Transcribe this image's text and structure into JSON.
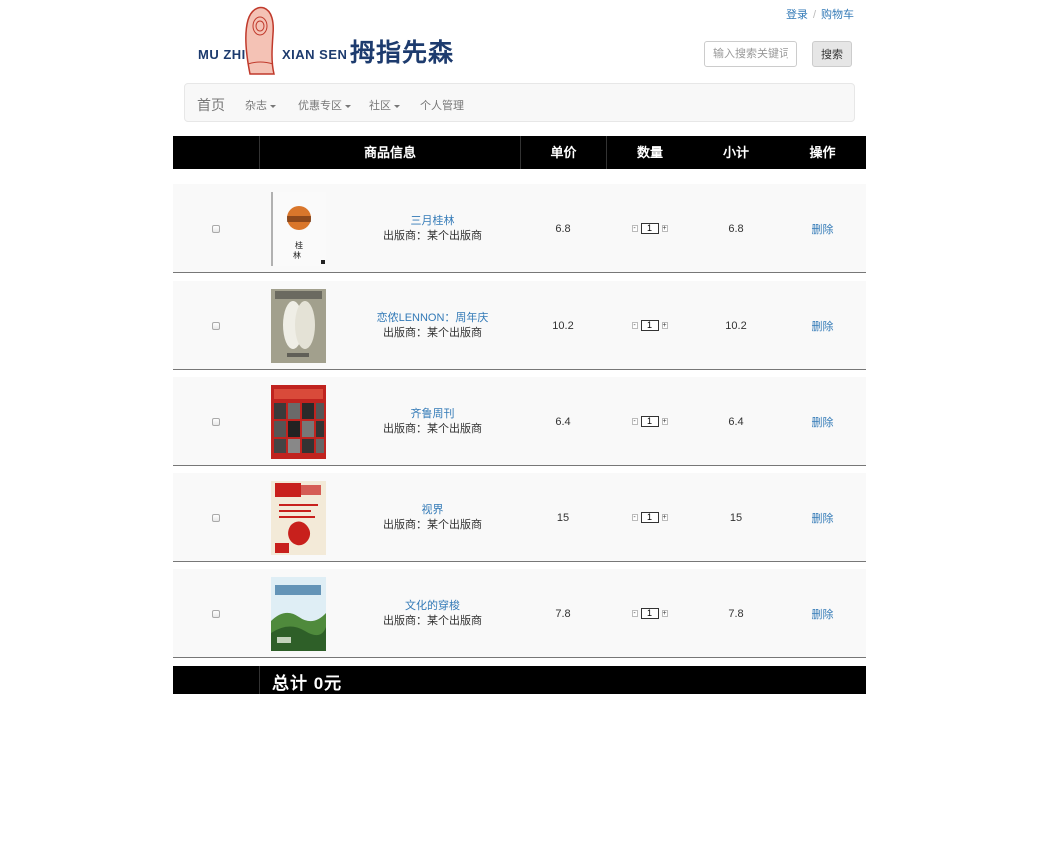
{
  "brand": {
    "en_left": "MU ZHI",
    "en_right": "XIAN SEN",
    "cn": "拇指先森"
  },
  "top_links": {
    "login": "登录",
    "separator": "/",
    "cart": "购物车"
  },
  "search": {
    "placeholder": "输入搜索关键词",
    "button": "搜索"
  },
  "navbar": {
    "home": "首页",
    "items": [
      "杂志",
      "优惠专区",
      "社区",
      "个人管理"
    ]
  },
  "table": {
    "headers": [
      "",
      "商品信息",
      "单价",
      "数量",
      "小计",
      "操作"
    ],
    "rows": [
      {
        "title": "三月桂林",
        "publisher": "出版商：某个出版商",
        "price": "6.8",
        "qty": "1",
        "subtotal": "6.8",
        "action": "删除",
        "cover": "landscape-sunset-cover"
      },
      {
        "title": "恋侬LENNON：周年庆",
        "publisher": "出版商：某个出版商",
        "price": "10.2",
        "qty": "1",
        "subtotal": "10.2",
        "action": "删除",
        "cover": "lennon-wings-cover"
      },
      {
        "title": "齐鲁周刊",
        "publisher": "出版商：某个出版商",
        "price": "6.4",
        "qty": "1",
        "subtotal": "6.4",
        "action": "删除",
        "cover": "qilu-weekly-cover"
      },
      {
        "title": "视界",
        "publisher": "出版商：某个出版商",
        "price": "15",
        "qty": "1",
        "subtotal": "15",
        "action": "删除",
        "cover": "shijie-papercut-cover"
      },
      {
        "title": "文化的穿梭",
        "publisher": "出版商：某个出版商",
        "price": "7.8",
        "qty": "1",
        "subtotal": "7.8",
        "action": "删除",
        "cover": "culture-hills-cover"
      }
    ],
    "qty_minus": "-",
    "qty_plus": "+",
    "total": "总计 0元"
  },
  "colors": {
    "link": "#337ab7",
    "brand_blue": "#1d3b6e",
    "header_bg": "#000000",
    "row_bg": "#f9f9f9"
  }
}
